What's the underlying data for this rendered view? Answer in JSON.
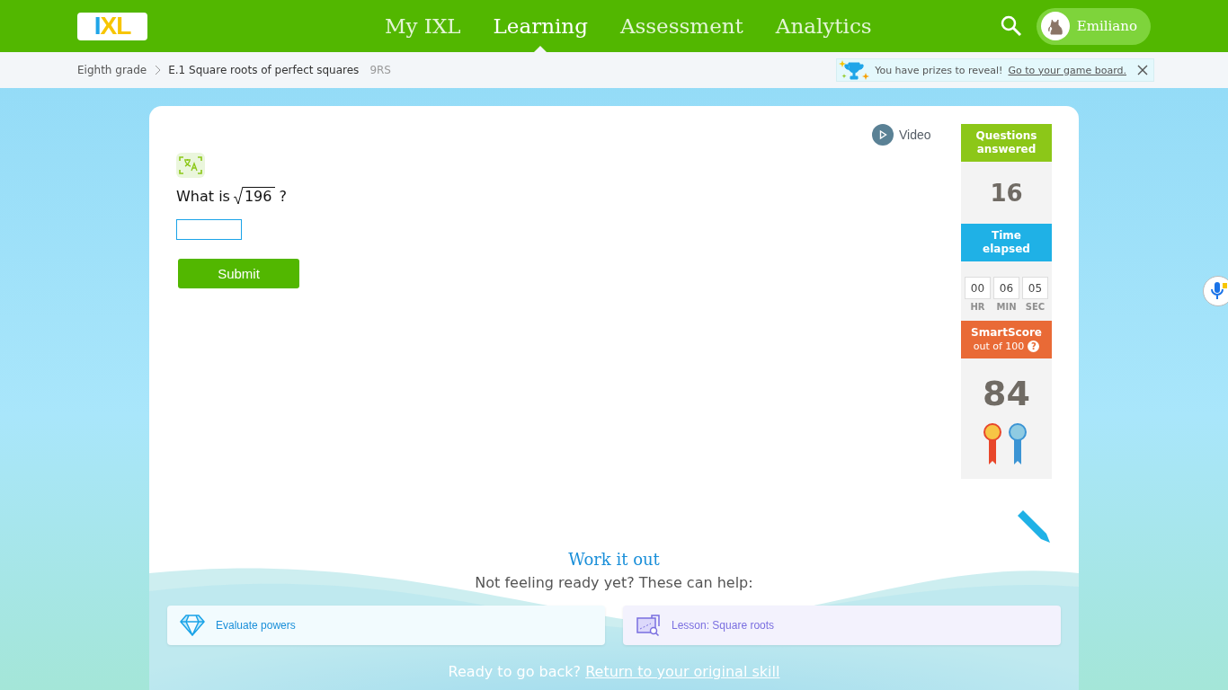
{
  "header": {
    "logo": "IXL",
    "nav": [
      {
        "label": "My IXL",
        "selected": false
      },
      {
        "label": "Learning",
        "selected": true
      },
      {
        "label": "Assessment",
        "selected": false
      },
      {
        "label": "Analytics",
        "selected": false
      }
    ],
    "user": "Emiliano"
  },
  "breadcrumb": {
    "items": [
      "Eighth grade",
      "E.1 Square roots of perfect squares"
    ],
    "code": "9RS"
  },
  "prize_banner": {
    "text": "You have prizes to reveal!",
    "link": "Go to your game board."
  },
  "question": {
    "video": "Video",
    "prefix": "What is",
    "radicand": "196",
    "suffix": "?",
    "submit": "Submit"
  },
  "stats": {
    "questions_label": "Questions answered",
    "questions": "16",
    "time_label": "Time elapsed",
    "time": [
      {
        "value": "00",
        "unit": "HR"
      },
      {
        "value": "06",
        "unit": "MIN"
      },
      {
        "value": "05",
        "unit": "SEC"
      }
    ],
    "score_label": "SmartScore",
    "score_sub": "out of 100",
    "score_help": "?",
    "score": "84"
  },
  "help": {
    "title": "Work it out",
    "subtitle": "Not feeling ready yet? These can help:",
    "cards": [
      {
        "kind": "skill",
        "label": "Evaluate powers"
      },
      {
        "kind": "lesson",
        "label": "Lesson: Square roots"
      }
    ],
    "back_text": "Ready to go back?",
    "back_link": "Return to your original skill"
  }
}
